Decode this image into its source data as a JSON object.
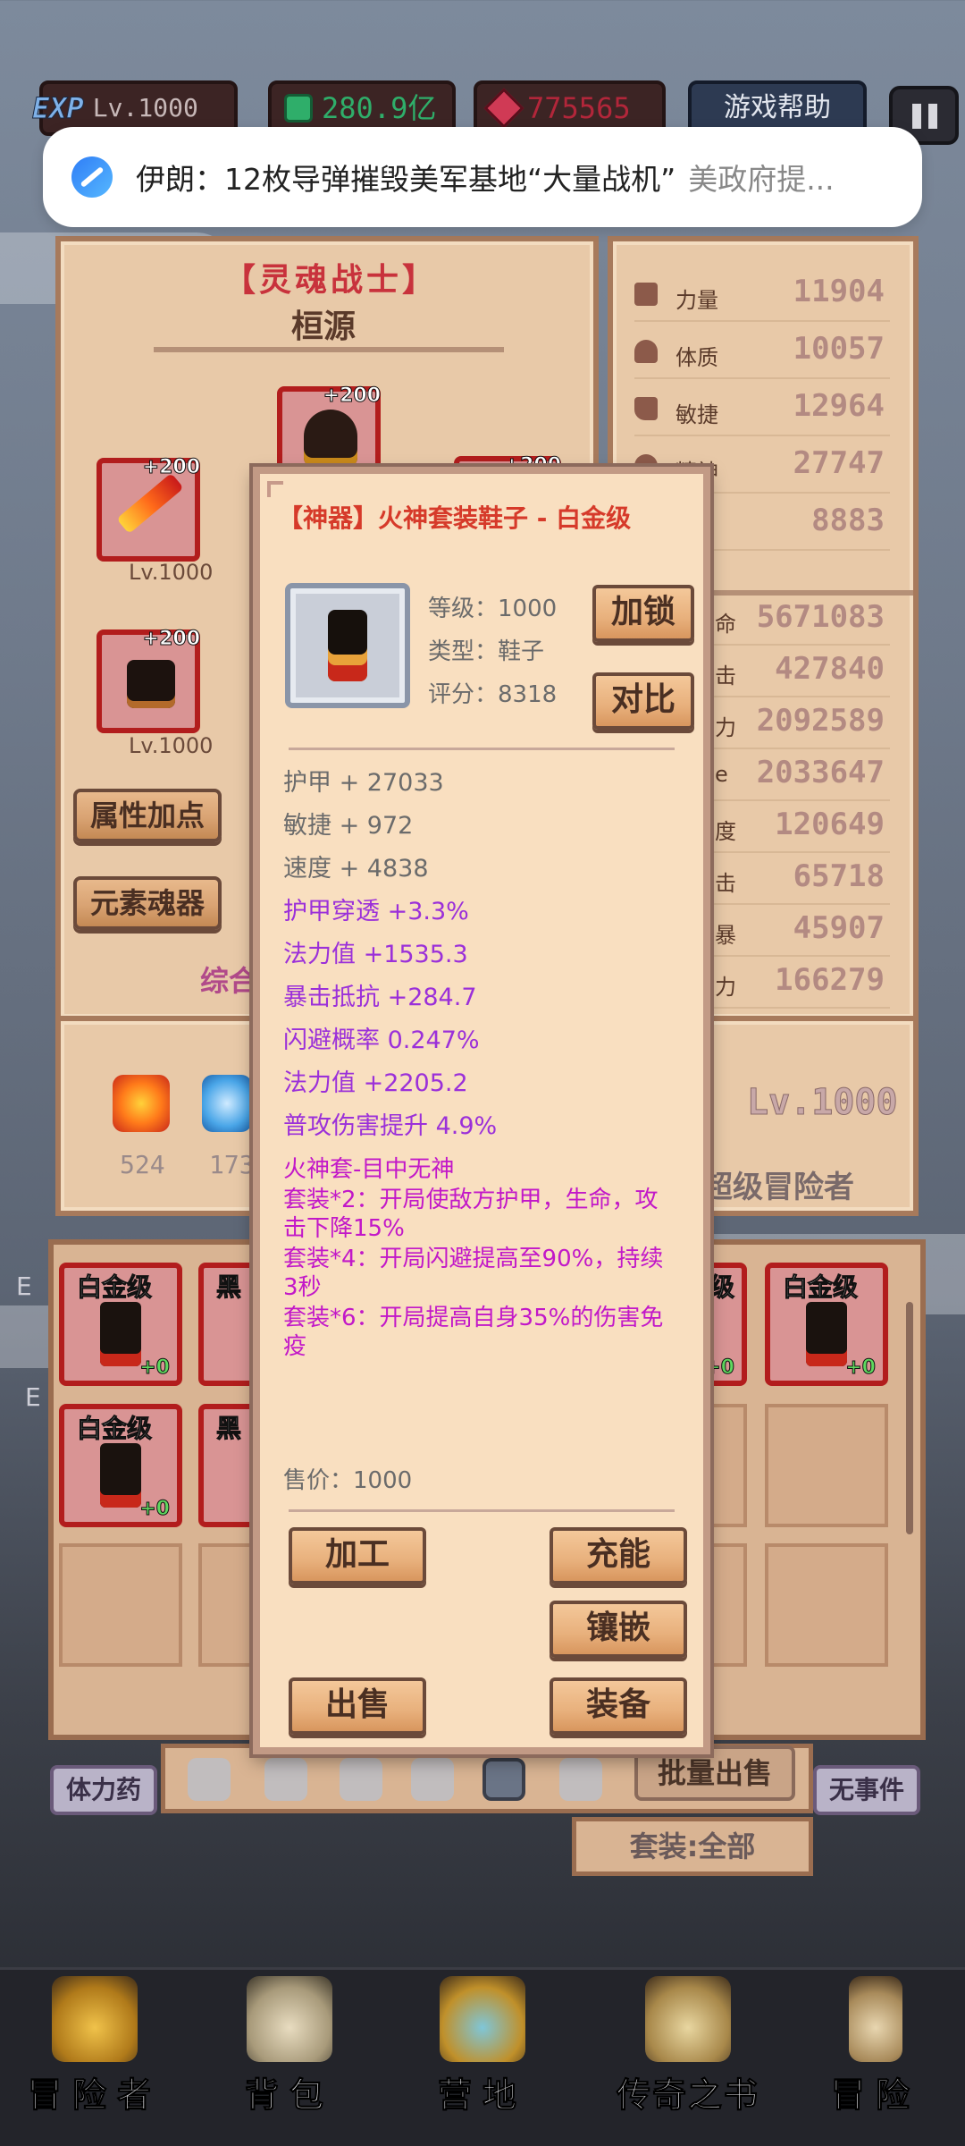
{
  "topbar": {
    "exp_badge": "EXP",
    "level": "Lv.1000",
    "gems": "280.9亿",
    "rubies": "775565",
    "help_button": "游戏帮助"
  },
  "notification": {
    "title": "伊朗：12枚导弹摧毁美军基地“大量战机”",
    "subtitle": "美政府提..."
  },
  "hero": {
    "class_title": "【灵魂战士】",
    "name": "桓源",
    "slots": [
      {
        "plus": "+200",
        "level": "Lv.1000",
        "icon": "flame-sword-icon"
      },
      {
        "plus": "+200",
        "level": "",
        "icon": "demon-helmet-icon"
      },
      {
        "plus": "+200",
        "level": "",
        "icon": "chest-armor-icon"
      },
      {
        "plus": "+200",
        "level": "Lv.1000",
        "icon": "gauntlet-icon"
      }
    ],
    "attr_button": "属性加点",
    "element_button": "元素魂器",
    "combined_label": "综合",
    "inventory_counts": [
      "524",
      "173"
    ],
    "hero_level": "Lv.1000",
    "rank_title": "超级冒险者"
  },
  "stats": [
    {
      "label": "力量",
      "value": "11904",
      "icon": "strength-icon"
    },
    {
      "label": "体质",
      "value": "10057",
      "icon": "heart-icon"
    },
    {
      "label": "敏捷",
      "value": "12964",
      "icon": "boot-icon"
    },
    {
      "label": "精神",
      "value": "27747",
      "icon": "mind-icon"
    },
    {
      "label": "力",
      "value": "8883",
      "icon": "power-icon"
    }
  ],
  "combat_stats": [
    {
      "label": "命",
      "value": "5671083"
    },
    {
      "label": "击",
      "value": "427840"
    },
    {
      "label": "力",
      "value": "2092589"
    },
    {
      "label": "e",
      "value": "2033647"
    },
    {
      "label": "度",
      "value": "120649"
    },
    {
      "label": "击",
      "value": "65718"
    },
    {
      "label": "暴",
      "value": "45907"
    },
    {
      "label": "力",
      "value": "166279"
    }
  ],
  "inventory": {
    "items": [
      {
        "tier": "白金级",
        "plus": "+0"
      },
      {
        "tier": "黑",
        "plus": ""
      },
      {
        "tier": "级",
        "plus": "+0"
      },
      {
        "tier": "白金级",
        "plus": "+0"
      },
      {
        "tier": "白金级",
        "plus": "+0"
      },
      {
        "tier": "黑",
        "plus": ""
      }
    ],
    "side_left": "E",
    "side_left2": "E",
    "potion_label": "体力药",
    "no_event_label": "无事件",
    "batch_sell": "批量出售",
    "set_filter": "套装:全部"
  },
  "item_popup": {
    "title": "【神器】火神套装鞋子 - 白金级",
    "level_line": "等级：1000",
    "type_line": "类型：鞋子",
    "score_line": "评分：8318",
    "lock_button": "加锁",
    "compare_button": "对比",
    "base_stats": [
      "护甲 + 27033",
      "敏捷 + 972",
      "速度 + 4838"
    ],
    "bonus_stats": [
      "护甲穿透 +3.3%",
      "法力值 +1535.3",
      "暴击抵抗 +284.7",
      "闪避概率 0.247%",
      "法力值 +2205.2",
      "普攻伤害提升 4.9%"
    ],
    "set_name": "火神套-目中无神",
    "set_bonus_2": "套装*2：开局使敌方护甲，生命，攻击下降15%",
    "set_bonus_4": "套装*4：开局闪避提高至90%，持续3秒",
    "set_bonus_6": "套装*6：开局提高自身35%的伤害免疫",
    "price": "售价：1000",
    "process_button": "加工",
    "charge_button": "充能",
    "inlay_button": "镶嵌",
    "sell_button": "出售",
    "equip_button": "装备",
    "colors": {
      "title": "#d63a2a",
      "bonus": "#9b30d9",
      "set": "#c218c8"
    }
  },
  "bottom_nav": [
    {
      "label": "冒险者",
      "icon": "crown-icon"
    },
    {
      "label": "背包",
      "icon": "backpack-icon"
    },
    {
      "label": "营地",
      "icon": "camp-icon"
    },
    {
      "label": "传奇之书",
      "icon": "book-icon"
    },
    {
      "label": "冒险",
      "icon": "sword-icon"
    }
  ]
}
